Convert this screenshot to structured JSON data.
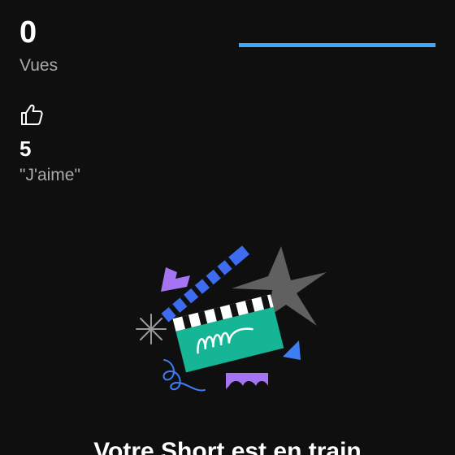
{
  "stats": {
    "views": {
      "value": "0",
      "label": "Vues"
    },
    "likes": {
      "value": "5",
      "label": "\"J'aime\"",
      "icon": "thumbs-up-icon"
    }
  },
  "upload": {
    "progress_percent": 100,
    "status_text": "Votre Short est en train"
  },
  "illustration": {
    "name": "clapperboard-illustration",
    "colors": {
      "clapper_body": "#15b595",
      "clapper_stripe": "#3d6cf0",
      "star": "#606060",
      "purple": "#a474f2",
      "blue_triangle": "#3d7ef5",
      "sparkle": "#9a9a9a",
      "swirl": "#3d7ef5"
    }
  },
  "colors": {
    "background": "#0f0f0f",
    "progress": "#3ea6ff",
    "secondary_text": "#aaaaaa"
  }
}
